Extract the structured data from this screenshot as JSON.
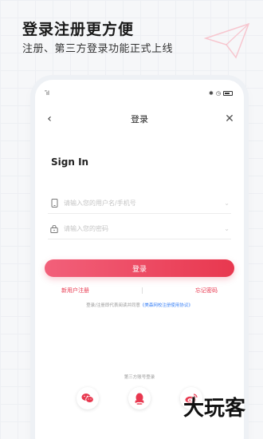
{
  "promo": {
    "title": "登录注册更方便",
    "subtitle": "注册、第三方登录功能正式上线"
  },
  "status_bar": {
    "signal": "᳛ıl",
    "icons": [
      "bluetooth-icon",
      "alarm-icon",
      "battery-icon"
    ]
  },
  "nav": {
    "title": "登录"
  },
  "form": {
    "heading": "Sign In",
    "username_placeholder": "请输入您的用户名/手机号",
    "password_placeholder": "请输入您的密码",
    "submit_label": "登录"
  },
  "links": {
    "register": "新用户注册",
    "forgot": "忘记密码"
  },
  "agreement": {
    "prefix": "登录/注册即代表阅读并同意",
    "link": "《美森网校注册使用协议》"
  },
  "third_party": {
    "title": "第三方账号登录",
    "providers": [
      "wechat-icon",
      "qq-icon",
      "weibo-icon"
    ]
  },
  "watermark": "大玩客",
  "colors": {
    "accent": "#e8384f",
    "accent_light": "#f2607a",
    "link_blue": "#3b82f6"
  }
}
